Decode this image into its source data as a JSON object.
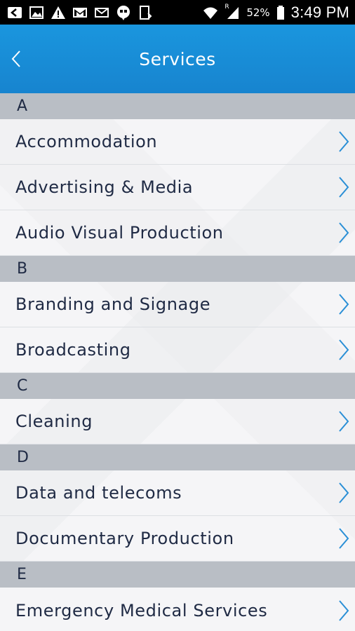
{
  "status_bar": {
    "icons_left": [
      "back-arrow-icon",
      "image-icon",
      "warning-icon",
      "gmail-icon",
      "email-icon",
      "hangouts-icon",
      "download-icon"
    ],
    "icons_right": [
      "wifi-icon",
      "signal-icon"
    ],
    "roaming": "R",
    "battery": "52%",
    "time": "3:49 PM"
  },
  "header": {
    "title": "Services",
    "back_icon": "chevron-left-icon",
    "color": "#1a8fd8"
  },
  "sections": [
    {
      "letter": "A",
      "items": [
        "Accommodation",
        "Advertising & Media",
        "Audio Visual Production"
      ]
    },
    {
      "letter": "B",
      "items": [
        "Branding and Signage",
        "Broadcasting"
      ]
    },
    {
      "letter": "C",
      "items": [
        "Cleaning"
      ]
    },
    {
      "letter": "D",
      "items": [
        "Data and telecoms",
        "Documentary Production"
      ]
    },
    {
      "letter": "E",
      "items": [
        "Emergency Medical Services"
      ]
    }
  ],
  "colors": {
    "section_header_bg": "#b9bec5",
    "text": "#1f2a44",
    "chevron": "#2a8fd6"
  }
}
